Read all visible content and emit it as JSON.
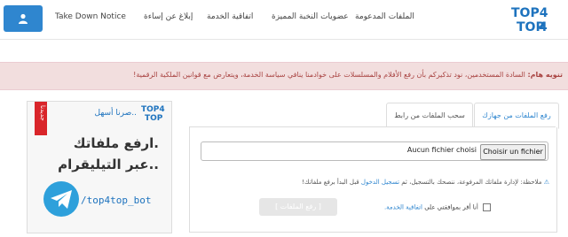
{
  "header": {
    "nav": [
      "الملفات المدعومة",
      "عضويات النخبة المميزة",
      "اتفاقية الخدمة",
      "إبلاغ عن إساءة",
      "Take Down Notice"
    ],
    "logo_top": "TOP4",
    "logo_bottom": "TOP"
  },
  "alert": {
    "title": "تنويه هام:",
    "message": "السادة المستخدمين، نود تذكيركم بأن رفع الأفلام والمسلسلات على خوادمنا ينافي سياسة الخدمة، ويتعارض مع قوانين الملكية الرقمية!"
  },
  "tabs": {
    "upload_local": "رفع الملفات من جهازك",
    "upload_link": "سحب الملفات من رابط"
  },
  "upload": {
    "choose_file": "Choisir un fichier",
    "no_file": "Aucun fichier choisi",
    "note_prefix": "ملاحظة: لإدارة ملفاتك المرفوعة، ننصحك بالتسجيل، ثم",
    "note_link": "تسجيل الدخول",
    "note_suffix": "قبل البدأ برفع ملفاتك!",
    "terms_prefix": "أنا أقر بموافقتي على",
    "terms_link": "اتفاقية الخدمة.",
    "upload_button": "[ رفع الملفات ]"
  },
  "banner": {
    "logo_top": "TOP4",
    "logo_bottom": "TOP",
    "tagline": "صرنا أسهل..",
    "new_badge": "جديدنا",
    "line1": "ارفع ملفاتك.",
    "line2": "عبر التيليقرام..",
    "bot": "/top4top_bot"
  },
  "colors": {
    "primary": "#2f86cf",
    "alert_bg": "#f2dede",
    "alert_text": "#a94442"
  }
}
